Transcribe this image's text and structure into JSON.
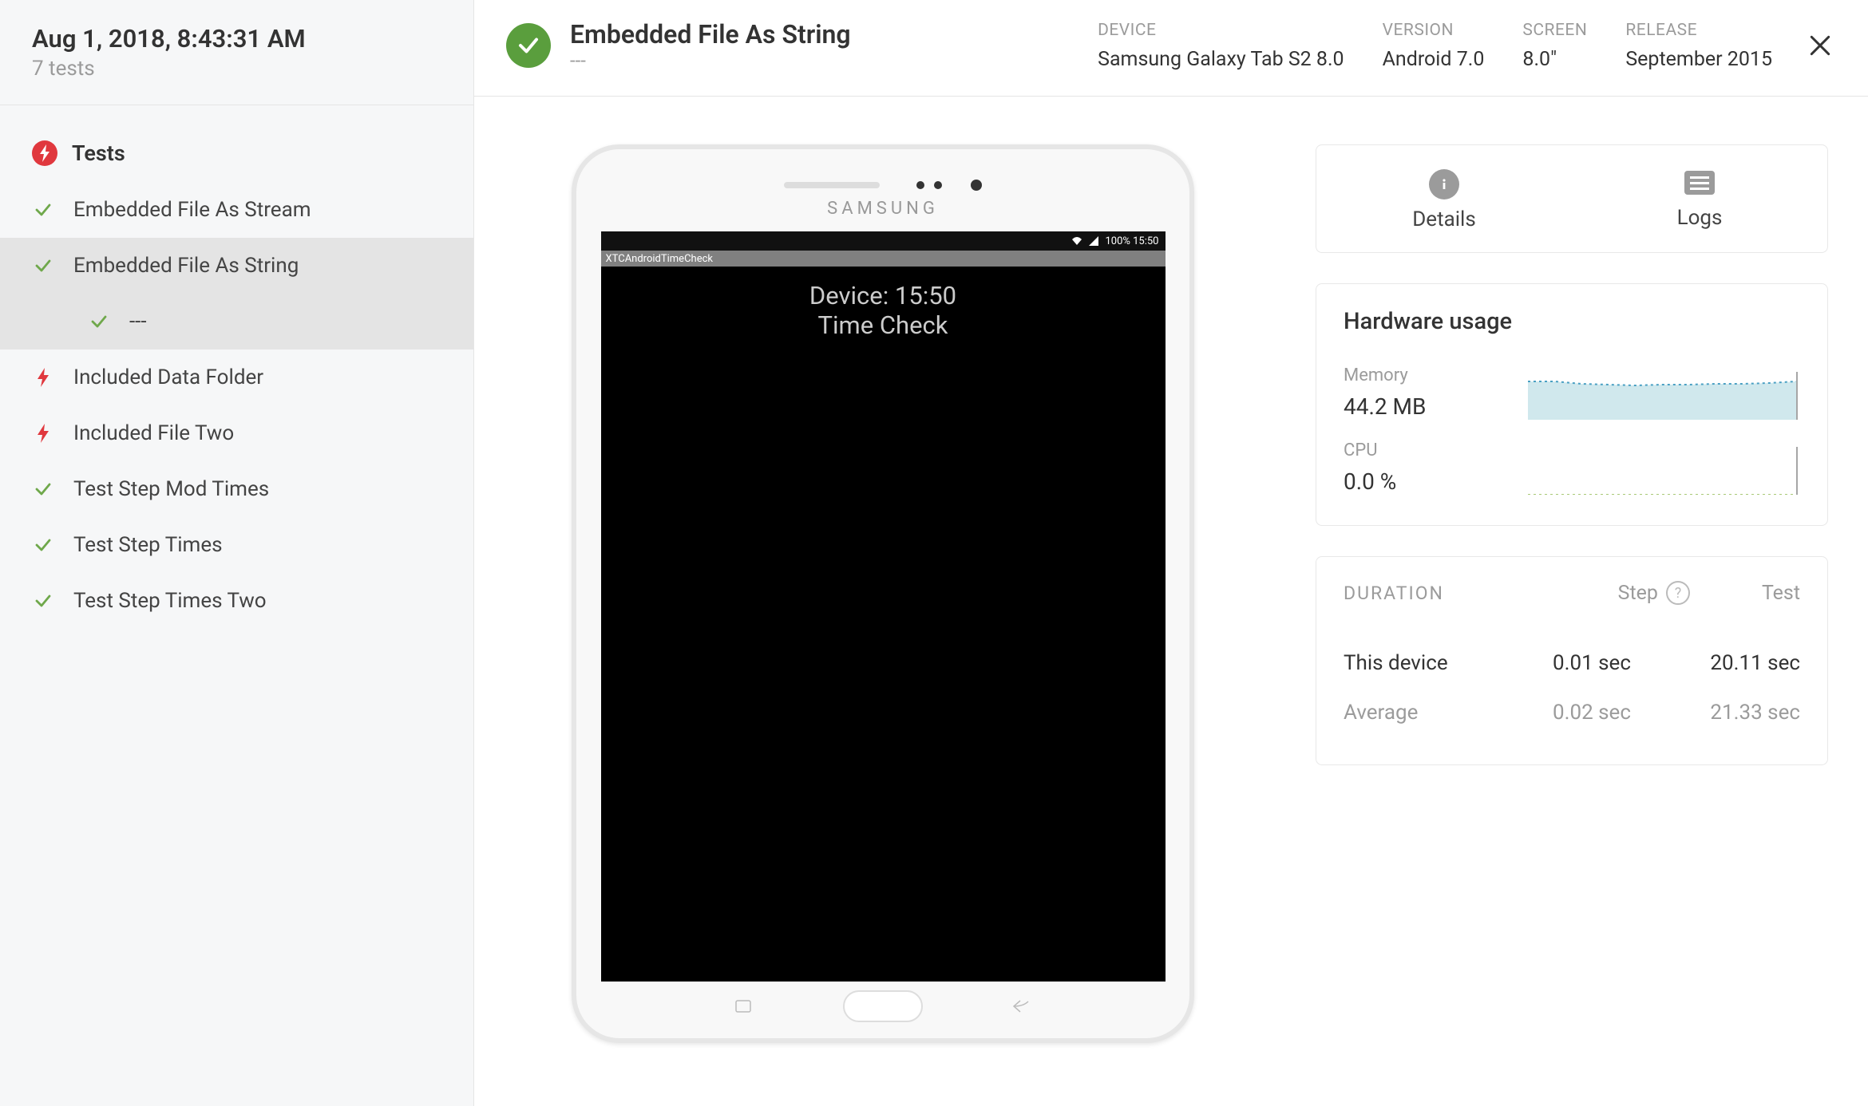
{
  "sidebar": {
    "header_title": "Aug 1, 2018, 8:43:31 AM",
    "header_sub": "7 tests",
    "tests_label": "Tests",
    "items": [
      {
        "name": "Embedded File As Stream",
        "status": "pass"
      },
      {
        "name": "Embedded File As String",
        "status": "pass",
        "selected": true,
        "substep": "---"
      },
      {
        "name": "Included Data Folder",
        "status": "fail"
      },
      {
        "name": "Included File Two",
        "status": "fail"
      },
      {
        "name": "Test Step Mod Times",
        "status": "pass"
      },
      {
        "name": "Test Step Times",
        "status": "pass"
      },
      {
        "name": "Test Step Times Two",
        "status": "pass"
      }
    ]
  },
  "topbar": {
    "title": "Embedded File As String",
    "subtitle": "---",
    "device_label": "DEVICE",
    "device_value": "Samsung Galaxy Tab S2 8.0",
    "version_label": "VERSION",
    "version_value": "Android 7.0",
    "screen_label": "SCREEN",
    "screen_value": "8.0\"",
    "release_label": "RELEASE",
    "release_value": "September 2015"
  },
  "device": {
    "brand": "SAMSUNG",
    "status_right": "100% 15:50",
    "appbar_title": "XTCAndroidTimeCheck",
    "line1": "Device: 15:50",
    "line2": "Time Check"
  },
  "tabs": {
    "details": "Details",
    "logs": "Logs"
  },
  "hardware": {
    "title": "Hardware usage",
    "memory_label": "Memory",
    "memory_value": "44.2 MB",
    "cpu_label": "CPU",
    "cpu_value": "0.0 %"
  },
  "duration": {
    "title": "DURATION",
    "step_label": "Step",
    "test_label": "Test",
    "this_device_label": "This device",
    "this_step": "0.01 sec",
    "this_test": "20.11 sec",
    "avg_label": "Average",
    "avg_step": "0.02 sec",
    "avg_test": "21.33 sec"
  },
  "colors": {
    "pass": "#6fa84b",
    "fail": "#e0383e"
  },
  "chart_data": {
    "memory": {
      "type": "area",
      "x": [
        0,
        1,
        2,
        3,
        4,
        5,
        6,
        7,
        8,
        9,
        10
      ],
      "values": [
        48,
        48,
        45,
        44,
        43,
        44,
        44,
        45,
        45,
        46,
        48
      ],
      "ylim": [
        0,
        60
      ],
      "color": "#a9d6df",
      "stroke": "#4aa0c3"
    },
    "cpu": {
      "type": "line",
      "x": [
        0,
        1,
        2,
        3,
        4,
        5,
        6,
        7,
        8,
        9,
        10
      ],
      "values": [
        0,
        0,
        0,
        0,
        0,
        0,
        0,
        0,
        0,
        0,
        0
      ],
      "ylim": [
        0,
        100
      ],
      "color": "#a9c978"
    }
  }
}
